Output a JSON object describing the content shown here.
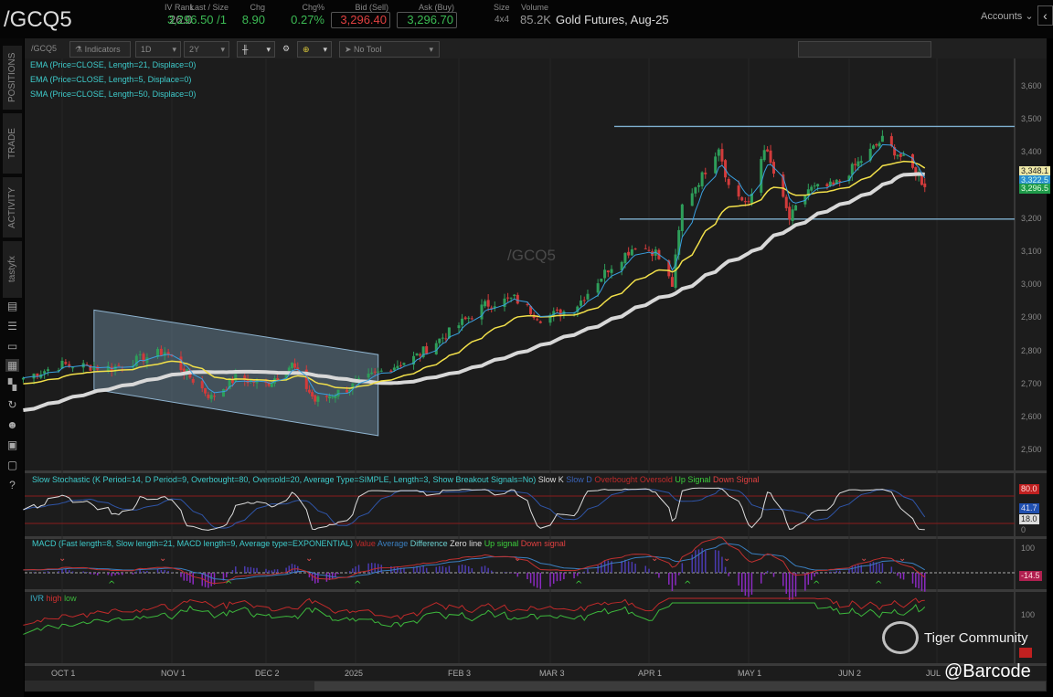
{
  "header": {
    "symbol": "/GCQ5",
    "iv_rank_label": "IV Rank",
    "iv_rank": "26.0",
    "last_label": "Last / Size",
    "last": "3,296.50 /1",
    "chg_label": "Chg",
    "chg": "8.90",
    "chgpct_label": "Chg%",
    "chgpct": "0.27%",
    "bid_label": "Bid (Sell)",
    "bid": "3,296.40",
    "ask_label": "Ask (Buy)",
    "ask": "3,296.70",
    "size_label": "Size",
    "size": "4x4",
    "volume_label": "Volume",
    "volume": "85.2K",
    "description": "Gold Futures, Aug-25",
    "accounts": "Accounts"
  },
  "sidebar": {
    "tabs": [
      "POSITIONS",
      "TRADE",
      "ACTIVITY",
      "tastyfx"
    ]
  },
  "toolbar": {
    "symbol": "/GCQ5",
    "indicators": "Indicators",
    "interval": "1D",
    "range": "2Y",
    "tool": "No Tool"
  },
  "studies": {
    "ema21": "EMA (Price=CLOSE, Length=21, Displace=0)",
    "ema5": "EMA (Price=CLOSE, Length=5, Displace=0)",
    "sma50": "SMA (Price=CLOSE, Length=50, Displace=0)",
    "stoch": "Slow Stochastic (K Period=14, D Period=9, Overbought=80, Oversold=20, Average Type=SIMPLE, Length=3, Show Breakout Signals=No)",
    "stoch_legend": [
      "Slow K",
      "Slow D",
      "Overbought",
      "Oversold",
      "Up Signal",
      "Down Signal"
    ],
    "macd": "MACD (Fast length=8, Slow length=21, MACD length=9, Average type=EXPONENTIAL)",
    "macd_legend": [
      "Value",
      "Average",
      "Difference",
      "Zero line",
      "Up signal",
      "Down signal"
    ],
    "ivr": "IVR",
    "ivr_legend": [
      "high",
      "low"
    ]
  },
  "watermark": "/GCQ5",
  "price_axis": [
    "3,600",
    "3,500",
    "3,400",
    "3,300",
    "3,200",
    "3,100",
    "3,000",
    "2,900",
    "2,800",
    "2,700",
    "2,600",
    "2,500"
  ],
  "price_tags": {
    "ema21": "3,348.1",
    "ema5": "3,322.5",
    "last": "3,296.5"
  },
  "stoch_axis": {
    "ob": "80.0",
    "d": "41.7",
    "k": "18.0",
    "zero": "0"
  },
  "macd_axis": {
    "top": "100",
    "value": "-14.5"
  },
  "ivr_axis": {
    "top": "100"
  },
  "date_axis": [
    "OCT 1",
    "NOV 1",
    "DEC 2",
    "2025",
    "FEB 3",
    "MAR 3",
    "APR 1",
    "MAY 1",
    "JUN 2",
    "JUL"
  ],
  "overlay": {
    "community": "Tiger Community",
    "handle": "@Barcode"
  },
  "colors": {
    "up": "#2e9e5a",
    "down": "#d23b3b",
    "ema21": "#f2e04a",
    "ema5": "#3aa0e0",
    "sma50": "#d8d8d8",
    "hline": "#7fb0d0"
  },
  "chart_data": {
    "type": "candlestick",
    "title": "/GCQ5",
    "ylim": [
      2450,
      3650
    ],
    "close_anchors": [
      [
        "2024-09-20",
        2720
      ],
      [
        "2024-10-01",
        2760
      ],
      [
        "2024-10-15",
        2750
      ],
      [
        "2024-10-30",
        2800
      ],
      [
        "2024-11-05",
        2740
      ],
      [
        "2024-11-14",
        2660
      ],
      [
        "2024-11-22",
        2720
      ],
      [
        "2024-12-02",
        2700
      ],
      [
        "2024-12-11",
        2760
      ],
      [
        "2024-12-19",
        2650
      ],
      [
        "2024-12-31",
        2690
      ],
      [
        "2025-01-10",
        2740
      ],
      [
        "2025-01-20",
        2780
      ],
      [
        "2025-01-30",
        2850
      ],
      [
        "2025-02-11",
        2940
      ],
      [
        "2025-02-20",
        2960
      ],
      [
        "2025-02-28",
        2900
      ],
      [
        "2025-03-10",
        2930
      ],
      [
        "2025-03-20",
        3050
      ],
      [
        "2025-03-28",
        3120
      ],
      [
        "2025-04-03",
        3100
      ],
      [
        "2025-04-08",
        3000
      ],
      [
        "2025-04-11",
        3240
      ],
      [
        "2025-04-17",
        3330
      ],
      [
        "2025-04-22",
        3420
      ],
      [
        "2025-04-25",
        3300
      ],
      [
        "2025-05-01",
        3240
      ],
      [
        "2025-05-06",
        3420
      ],
      [
        "2025-05-14",
        3200
      ],
      [
        "2025-05-20",
        3290
      ],
      [
        "2025-05-28",
        3300
      ],
      [
        "2025-06-05",
        3370
      ],
      [
        "2025-06-13",
        3440
      ],
      [
        "2025-06-20",
        3380
      ],
      [
        "2025-06-25",
        3330
      ],
      [
        "2025-06-27",
        3296.5
      ]
    ],
    "horizontal_levels": [
      3480,
      3200
    ],
    "channel": {
      "start": "2024-10-10",
      "end": "2025-01-09",
      "upper": [
        2925,
        2790
      ],
      "lower": [
        2685,
        2545
      ]
    }
  }
}
